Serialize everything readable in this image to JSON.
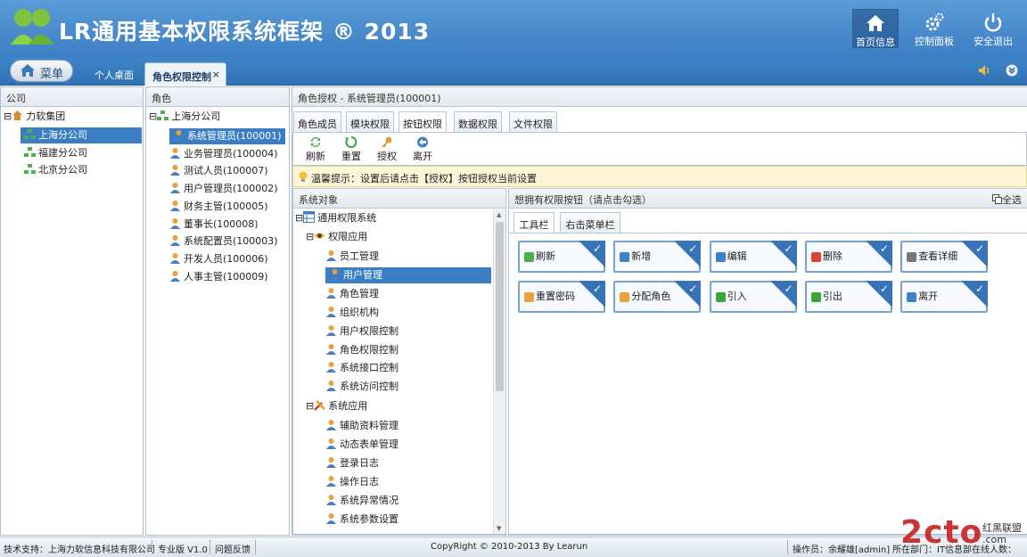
{
  "header": {
    "title": "LR通用基本权限系统框架 ® 2013",
    "buttons": [
      {
        "label": "首页信息"
      },
      {
        "label": "控制面板"
      },
      {
        "label": "安全退出"
      }
    ]
  },
  "nav": {
    "menu_label": "菜单",
    "tabs": [
      {
        "label": "个人桌面"
      },
      {
        "label": "角色权限控制",
        "close": "×"
      }
    ]
  },
  "company_panel": {
    "title": "公司",
    "root": "力软集团",
    "items": [
      "上海分公司",
      "福建分公司",
      "北京分公司"
    ]
  },
  "role_panel": {
    "title": "角色",
    "root": "上海分公司",
    "items": [
      "系统管理员(100001)",
      "业务管理员(100004)",
      "测试人员(100007)",
      "用户管理员(100002)",
      "财务主管(100005)",
      "董事长(100008)",
      "系统配置员(100003)",
      "开发人员(100006)",
      "人事主管(100009)"
    ]
  },
  "auth_panel": {
    "title": "角色授权 - 系统管理员(100001)",
    "tabs": [
      "角色成员",
      "模块权限",
      "按钮权限",
      "数据权限",
      "文件权限"
    ],
    "toolbar": [
      "刷新",
      "重置",
      "授权",
      "离开"
    ],
    "tip": "温馨提示：设置后请点击【授权】按钮授权当前设置"
  },
  "system_tree": {
    "title": "系统对象",
    "root": "通用权限系统",
    "group1": {
      "label": "权限应用",
      "items": [
        "员工管理",
        "用户管理",
        "角色管理",
        "组织机构",
        "用户权限控制",
        "角色权限控制",
        "系统接口控制",
        "系统访问控制"
      ]
    },
    "group2": {
      "label": "系统应用",
      "items": [
        "辅助资料管理",
        "动态表单管理",
        "登录日志",
        "操作日志",
        "系统异常情况",
        "系统参数设置"
      ]
    }
  },
  "perm_panel": {
    "title": "想拥有权限按钮（请点击勾选）",
    "select_all": "全选",
    "tabs": [
      "工具栏",
      "右击菜单栏"
    ],
    "buttons": [
      "刷新",
      "新增",
      "编辑",
      "删除",
      "查看详细",
      "重置密码",
      "分配角色",
      "引入",
      "引出",
      "离开"
    ],
    "check": "✓"
  },
  "footer": {
    "support": "技术支持：上海力软信息科技有限公司",
    "edition": "专业版 V1.0",
    "feedback": "问题反馈",
    "copyright": "CopyRight © 2010-2013 By Learun",
    "operator": "操作员：余耀雄[admin]",
    "dept": "所在部门：IT信息部",
    "online": "在线人数："
  },
  "watermark": {
    "text": "2cto",
    "cn": "红黑联盟",
    "com": ".com"
  },
  "colors": {
    "header": "#3c7fc4",
    "selection": "#3c7ec3",
    "check": "#3873b8"
  }
}
